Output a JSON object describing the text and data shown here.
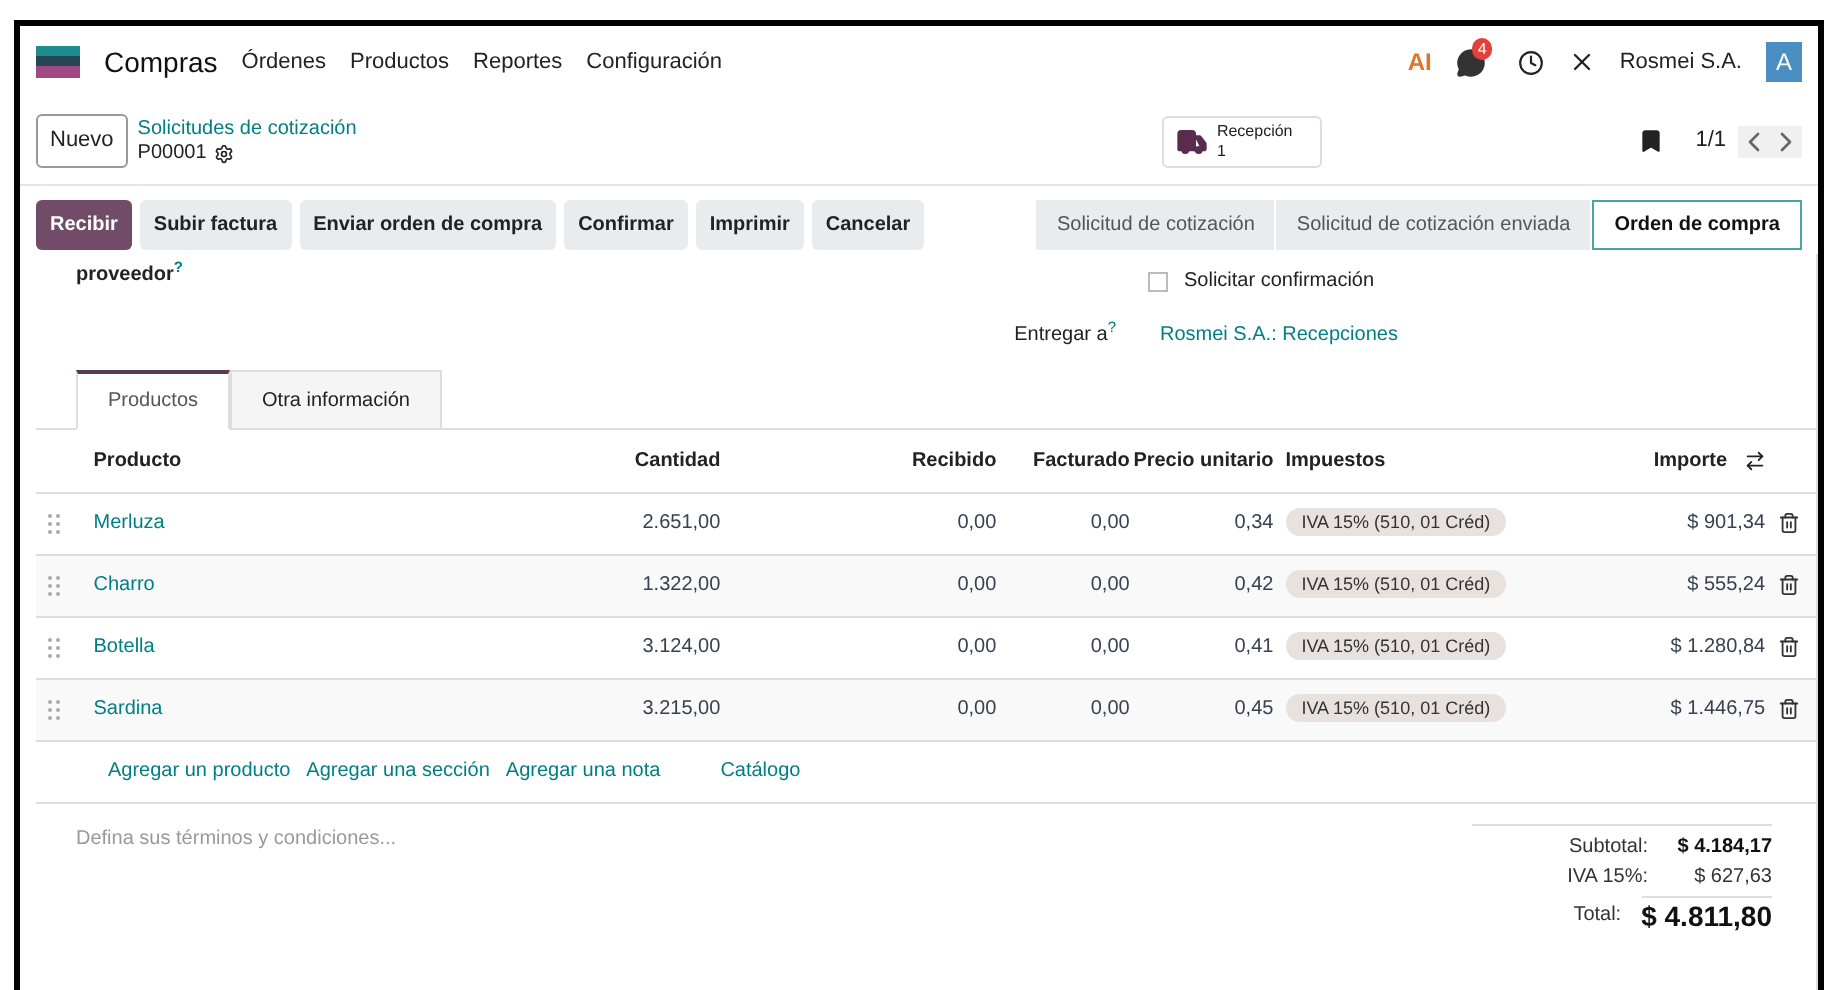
{
  "navbar": {
    "app": "Compras",
    "menus": [
      "Órdenes",
      "Productos",
      "Reportes",
      "Configuración"
    ],
    "ai": "AI",
    "messages_badge": "4",
    "company": "Rosmei S.A.",
    "avatar": "A"
  },
  "control_panel": {
    "new_button": "Nuevo",
    "breadcrumb": "Solicitudes de cotización",
    "record": "P00001",
    "smart_button": {
      "label": "Recepción",
      "count": "1"
    },
    "pager": "1/1"
  },
  "actions": [
    {
      "label": "Recibir",
      "primary": true
    },
    {
      "label": "Subir factura",
      "primary": false
    },
    {
      "label": "Enviar orden de compra",
      "primary": false
    },
    {
      "label": "Confirmar",
      "primary": false
    },
    {
      "label": "Imprimir",
      "primary": false
    },
    {
      "label": "Cancelar",
      "primary": false
    }
  ],
  "status_steps": [
    {
      "label": "Solicitud de cotización",
      "selected": false
    },
    {
      "label": "Solicitud de cotización enviada",
      "selected": false
    },
    {
      "label": "Orden de compra",
      "selected": true
    }
  ],
  "form": {
    "vendor_label": "proveedor",
    "vendor_help": "?",
    "confirm_label": "Solicitar confirmación",
    "confirm_checked": false,
    "deliver_label": "Entregar a",
    "deliver_help": "?",
    "deliver_value": "Rosmei S.A.: Recepciones"
  },
  "tabs": [
    {
      "label": "Productos",
      "selected": true
    },
    {
      "label": "Otra información",
      "selected": false
    }
  ],
  "table": {
    "columns": [
      "Producto",
      "Cantidad",
      "Recibido",
      "Facturado",
      "Precio unitario",
      "Impuestos",
      "Importe"
    ],
    "rows": [
      {
        "product": "Merluza",
        "quantity": "2.651,00",
        "received": "0,00",
        "billed": "0,00",
        "unit_price": "0,34",
        "tax": "IVA 15% (510, 01 Créd)",
        "amount": "$ 901,34"
      },
      {
        "product": "Charro",
        "quantity": "1.322,00",
        "received": "0,00",
        "billed": "0,00",
        "unit_price": "0,42",
        "tax": "IVA 15% (510, 01 Créd)",
        "amount": "$ 555,24"
      },
      {
        "product": "Botella",
        "quantity": "3.124,00",
        "received": "0,00",
        "billed": "0,00",
        "unit_price": "0,41",
        "tax": "IVA 15% (510, 01 Créd)",
        "amount": "$ 1.280,84"
      },
      {
        "product": "Sardina",
        "quantity": "3.215,00",
        "received": "0,00",
        "billed": "0,00",
        "unit_price": "0,45",
        "tax": "IVA 15% (510, 01 Créd)",
        "amount": "$ 1.446,75"
      }
    ],
    "add_links": [
      "Agregar un producto",
      "Agregar una sección",
      "Agregar una nota",
      "Catálogo"
    ]
  },
  "notes": {
    "placeholder": "Defina sus términos y condiciones..."
  },
  "totals": [
    {
      "label": "Subtotal:",
      "value": "$ 4.184,17",
      "kind": "subtotal"
    },
    {
      "label": "IVA 15%:",
      "value": "$ 627,63",
      "kind": "tax"
    },
    {
      "label": "Total:",
      "value": "$ 4.811,80",
      "kind": "total"
    }
  ]
}
